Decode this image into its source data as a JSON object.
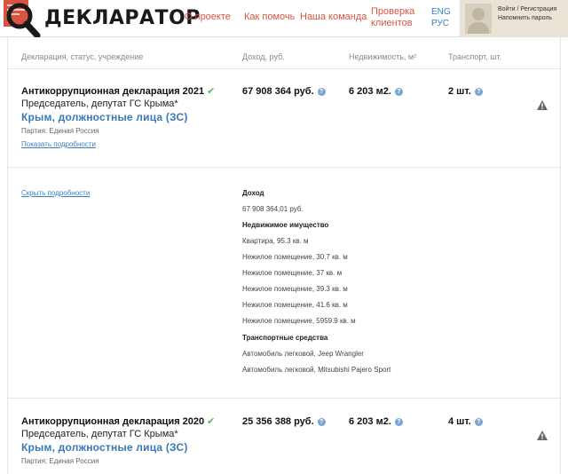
{
  "header": {
    "logo_text": "ДЕКЛАРАТОР",
    "nav": {
      "about": "О проекте",
      "help": "Как помочь",
      "team": "Наша команда",
      "check_line1": "Проверка",
      "check_line2": "клиентов"
    },
    "lang": {
      "eng": "ENG",
      "rus": "РУС"
    },
    "user": {
      "login": "Войти / Регистрация",
      "remind": "Напомнить пароль"
    }
  },
  "table_header": {
    "declaration": "Декларация, статус, учреждение",
    "income": "Доход, руб.",
    "realty": "Недвижимость, м²",
    "transport": "Транспорт, шт."
  },
  "declarations": [
    {
      "title": "Антикоррупционная декларация 2021",
      "check": "✔",
      "position": "Председатель, депутат ГС Крыма*",
      "region": "Крым, должностные лица (ЗС)",
      "party": "Партия: Единая Россия",
      "toggle": "Показать подробности",
      "income": "67 908 364 руб.",
      "realty": "6 203 м2.",
      "transport": "2 шт."
    },
    {
      "title": "Антикоррупционная декларация 2020",
      "check": "✔",
      "position": "Председатель, депутат ГС Крыма*",
      "region": "Крым, должностные лица (ЗС)",
      "party": "Партия: Единая Россия",
      "income": "25 356 388 руб.",
      "realty": "6 203 м2.",
      "transport": "4 шт."
    }
  ],
  "details": {
    "hide_link": "Скрыть подробности",
    "income_head": "Доход",
    "income_value": "67 908 364,01 руб.",
    "realty_head": "Недвижимое имущество",
    "realty_items": [
      "Квартира, 95.3 кв. м",
      "Нежилое помещение, 30.7 кв. м",
      "Нежилое помещение, 37 кв. м",
      "Нежилое помещение, 39.3 кв. м",
      "Нежилое помещение, 41.6 кв. м",
      "Нежилое помещение, 5959.9 кв. м"
    ],
    "transport_head": "Транспортные средства",
    "transport_items": [
      "Автомобиль легковой, Jeep Wrangler",
      "Автомобиль легковой, Mitsubishi Pajero Sport"
    ]
  },
  "icons": {
    "logo": "magnifier-document-icon",
    "check": "check-icon",
    "info": "info-icon",
    "warning": "warning-icon",
    "avatar": "user-silhouette-icon"
  },
  "colors": {
    "nav_link": "#d9543f",
    "link_blue": "#3b7fc4",
    "region": "#3a78b5",
    "check": "#5cb85c",
    "user_box": "#e8e3d5"
  }
}
